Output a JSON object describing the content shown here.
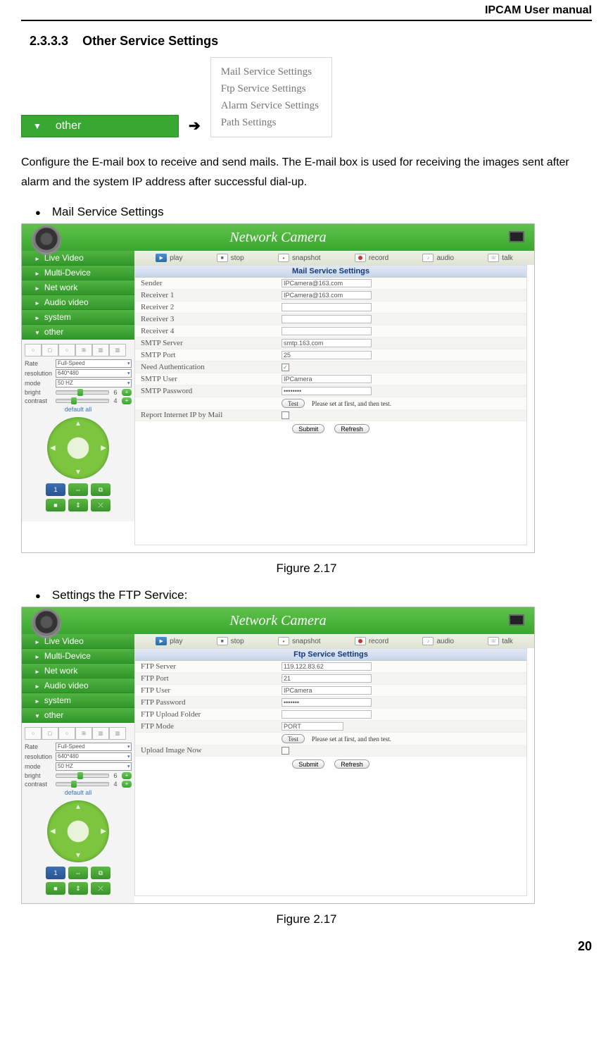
{
  "header": "IPCAM User manual",
  "section_num": "2.3.3.3",
  "section_title": "Other Service Settings",
  "arrow": "➔",
  "other_button": {
    "label": "other"
  },
  "other_menu": [
    "Mail Service Settings",
    "Ftp Service Settings",
    "Alarm Service Settings",
    "Path Settings"
  ],
  "para1": "Configure the E-mail box to receive and send mails. The E-mail box is used for receiving the images sent after alarm and the system IP address after successful dial-up.",
  "bullet1": "Mail Service Settings",
  "bullet2": "Settings the FTP Service:",
  "app_title": "Network Camera",
  "nav": [
    "Live Video",
    "Multi-Device",
    "Net work",
    "Audio video",
    "system",
    "other"
  ],
  "toolbar": [
    "play",
    "stop",
    "snapshot",
    "record",
    "audio",
    "talk"
  ],
  "ctrl": {
    "rate": "Rate",
    "rate_val": "Full-Speed",
    "res": "resolution",
    "res_val": "640*480",
    "mode": "mode",
    "mode_val": "50 HZ",
    "bright": "bright",
    "bright_val": "6",
    "contrast": "contrast",
    "contrast_val": "4",
    "default": "default all"
  },
  "mail": {
    "title": "Mail Service Settings",
    "rows": [
      {
        "label": "Sender",
        "value": "IPCamera@163.com"
      },
      {
        "label": "Receiver 1",
        "value": "IPCamera@163.com"
      },
      {
        "label": "Receiver 2",
        "value": ""
      },
      {
        "label": "Receiver 3",
        "value": ""
      },
      {
        "label": "Receiver 4",
        "value": ""
      },
      {
        "label": "SMTP Server",
        "value": "smtp.163.com"
      },
      {
        "label": "SMTP Port",
        "value": "25"
      },
      {
        "label": "Need Authentication",
        "value": "check"
      },
      {
        "label": "SMTP User",
        "value": "IPCamera"
      },
      {
        "label": "SMTP Password",
        "value": "••••••••"
      }
    ],
    "test": "Test",
    "test_note": "Please set at first, and then test.",
    "report_label": "Report Internet IP by Mail",
    "submit": "Submit",
    "refresh": "Refresh"
  },
  "ftp": {
    "title": "Ftp Service Settings",
    "rows": [
      {
        "label": "FTP Server",
        "value": "119.122.83.62"
      },
      {
        "label": "FTP Port",
        "value": "21"
      },
      {
        "label": "FTP User",
        "value": "IPCamera"
      },
      {
        "label": "FTP Password",
        "value": "•••••••"
      },
      {
        "label": "FTP Upload Folder",
        "value": ""
      },
      {
        "label": "FTP Mode",
        "value": "PORT"
      }
    ],
    "test": "Test",
    "test_note": "Please set at first, and then test.",
    "upload_label": "Upload Image Now",
    "submit": "Submit",
    "refresh": "Refresh"
  },
  "fig1": "Figure 2.17",
  "fig2": "Figure 2.17",
  "page": "20"
}
